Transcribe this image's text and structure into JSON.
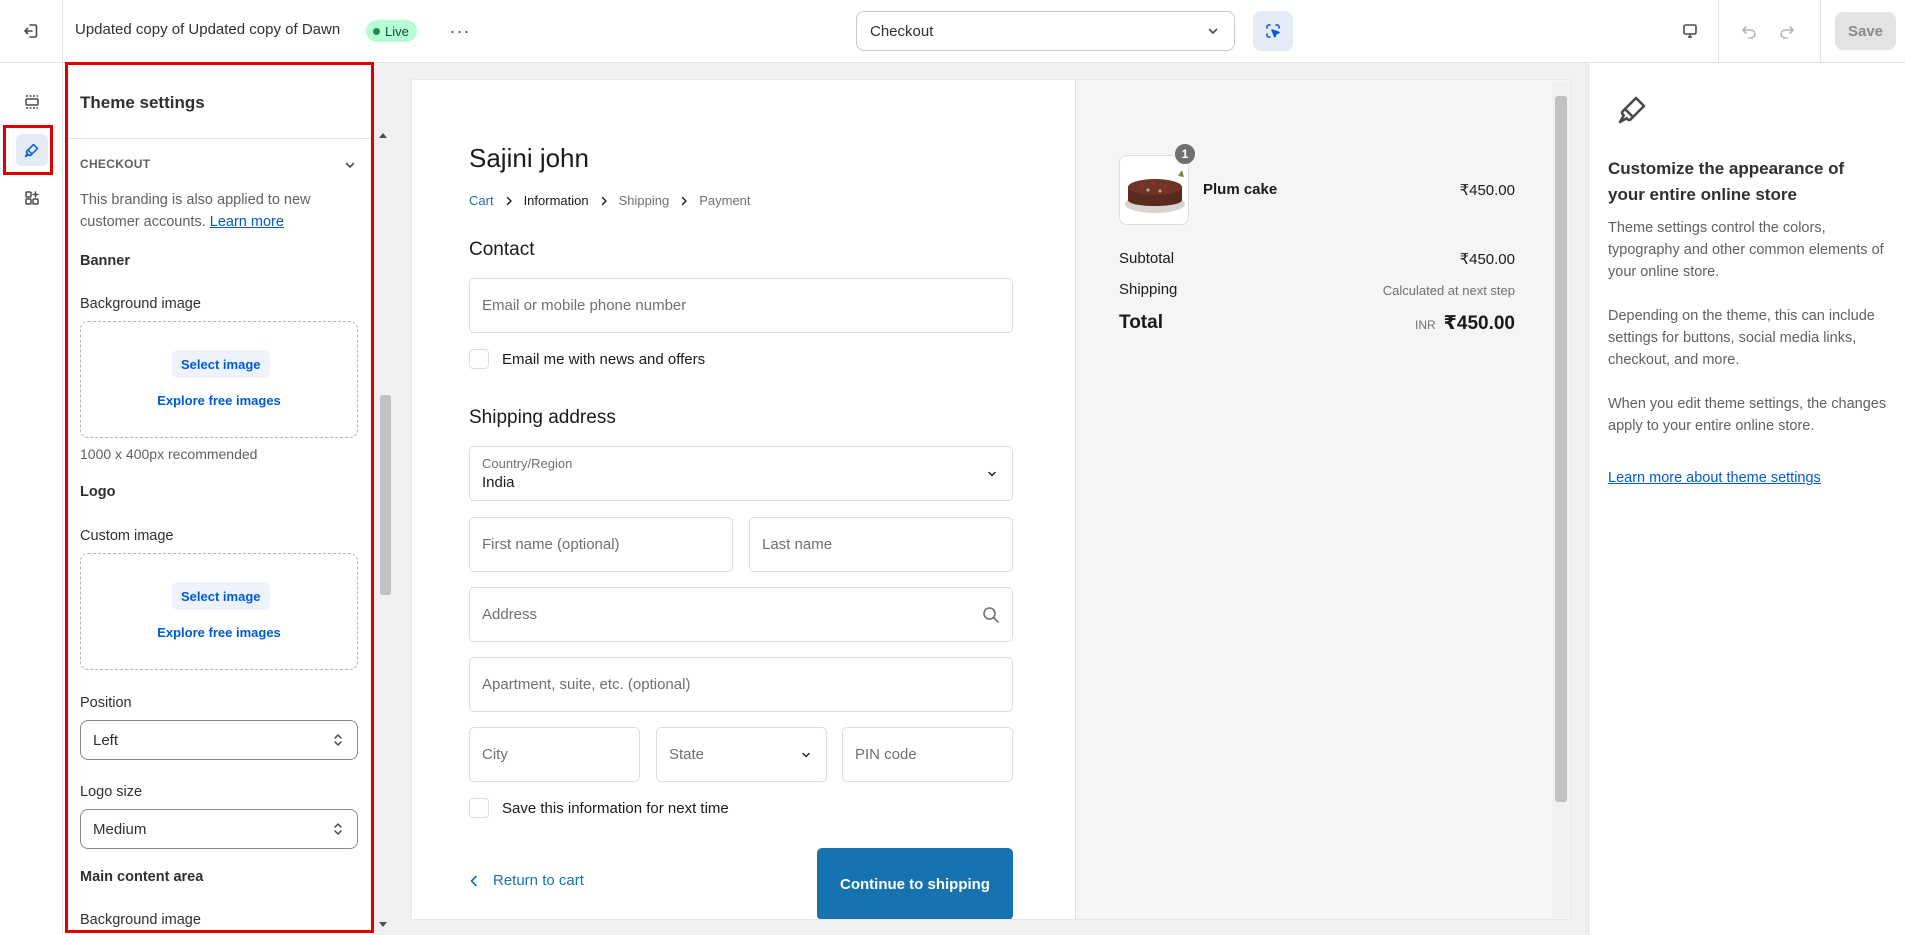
{
  "topbar": {
    "theme_name": "Updated copy of Updated copy of Dawn",
    "status_badge": "Live",
    "more_label": "···",
    "page_selector": "Checkout",
    "save_label": "Save"
  },
  "rail": {
    "items": [
      {
        "name": "sections",
        "icon": "sections-icon"
      },
      {
        "name": "theme-settings",
        "icon": "paintbrush-icon",
        "active": true
      },
      {
        "name": "app-embeds",
        "icon": "apps-icon"
      }
    ]
  },
  "settings_panel": {
    "title": "Theme settings",
    "section": "CHECKOUT",
    "help_text": "This branding is also applied to new customer accounts.",
    "help_link": "Learn more",
    "banner": {
      "heading": "Banner",
      "bg_label": "Background image",
      "select_image": "Select image",
      "explore": "Explore free images",
      "recommendation": "1000 x 400px recommended"
    },
    "logo": {
      "heading": "Logo",
      "custom_label": "Custom image",
      "select_image": "Select image",
      "explore": "Explore free images",
      "position_label": "Position",
      "position_value": "Left",
      "size_label": "Logo size",
      "size_value": "Medium"
    },
    "main_content": {
      "heading": "Main content area",
      "bg_label": "Background image"
    }
  },
  "preview": {
    "store_name": "Sajini john",
    "breadcrumbs": [
      "Cart",
      "Information",
      "Shipping",
      "Payment"
    ],
    "contact": {
      "heading": "Contact",
      "email_placeholder": "Email or mobile phone number",
      "news_label": "Email me with news and offers"
    },
    "shipping": {
      "heading": "Shipping address",
      "country_label": "Country/Region",
      "country_value": "India",
      "first_name": "First name (optional)",
      "last_name": "Last name",
      "address": "Address",
      "apartment": "Apartment, suite, etc. (optional)",
      "city": "City",
      "state": "State",
      "pin": "PIN code",
      "save_label": "Save this information for next time"
    },
    "return_link": "Return to cart",
    "continue_btn": "Continue to shipping",
    "order": {
      "item_name": "Plum cake",
      "item_qty": "1",
      "item_price": "₹450.00",
      "subtotal_label": "Subtotal",
      "subtotal_value": "₹450.00",
      "shipping_label": "Shipping",
      "shipping_value": "Calculated at next step",
      "total_label": "Total",
      "currency": "INR",
      "total_value": "₹450.00"
    }
  },
  "info_panel": {
    "title": "Customize the appearance of your entire online store",
    "p1": "Theme settings control the colors, typography and other common elements of your online store.",
    "p2": "Depending on the theme, this can include settings for buttons, social media links, checkout, and more.",
    "p3": "When you edit theme settings, the changes apply to your entire online store.",
    "link": "Learn more about theme settings"
  },
  "colors": {
    "accent": "#005bd3",
    "checkout_button": "#1773b0",
    "highlight_box": "#e00000",
    "live_badge": "#b4fed2"
  }
}
